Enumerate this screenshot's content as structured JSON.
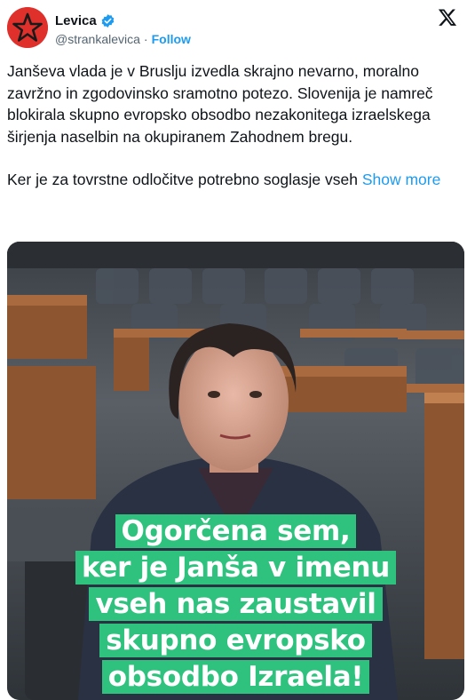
{
  "author": {
    "display_name": "Levica",
    "handle": "@strankalevica",
    "separator": "·",
    "follow_label": "Follow",
    "verified": true,
    "avatar_icon": "red-star-avatar-icon",
    "brand_color": "#e0302b"
  },
  "platform": {
    "logo_icon": "x-logo-icon"
  },
  "tweet": {
    "paragraph_1": "Janševa vlada je v Bruslju izvedla skrajno nevarno, moralno zavržno in zgodovinsko sramotno potezo. Slovenija je namreč blokirala skupno evropsko obsodbo nezakonitega izraelskega širjenja naselbin na okupiranem Zahodnem bregu.",
    "paragraph_2": "Ker je za tovrstne odločitve potrebno soglasje vseh",
    "show_more_label": "Show more",
    "link_color": "#1d9bf0"
  },
  "media": {
    "caption_lines": [
      "Ogorčena sem,",
      "ker je Janša v imenu",
      "vseh nas zaustavil",
      "skupno evropsko",
      "obsodbo Izraela!"
    ],
    "caption_bg_color": "#2ec27e"
  }
}
